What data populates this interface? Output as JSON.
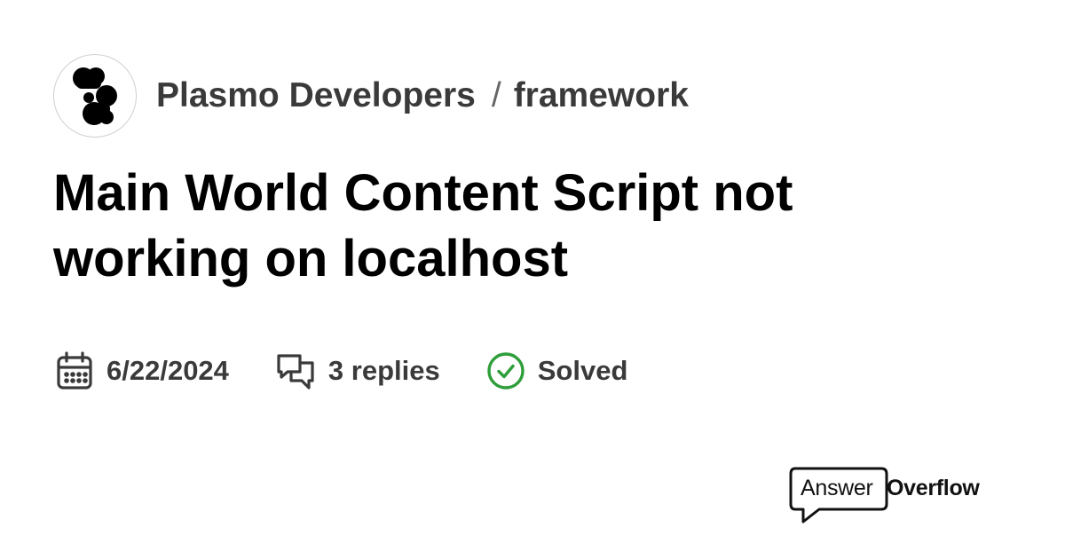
{
  "header": {
    "server_name": "Plasmo Developers",
    "separator": "/",
    "channel_name": "framework",
    "avatar_icon": "plasmo-logo-icon"
  },
  "thread": {
    "title": "Main World Content Script not working on localhost"
  },
  "meta": {
    "date": "6/22/2024",
    "date_icon": "calendar-icon",
    "replies": "3 replies",
    "replies_icon": "chat-bubbles-icon",
    "status": "Solved",
    "status_icon": "check-circle-icon"
  },
  "brand": {
    "answer": "Answer",
    "overflow": "Overflow",
    "icon": "speech-bubble-icon"
  },
  "colors": {
    "title": "#000000",
    "muted_text": "#3a3a3a",
    "solved_green": "#2e9e3a",
    "avatar_border": "#d0d0d0"
  }
}
